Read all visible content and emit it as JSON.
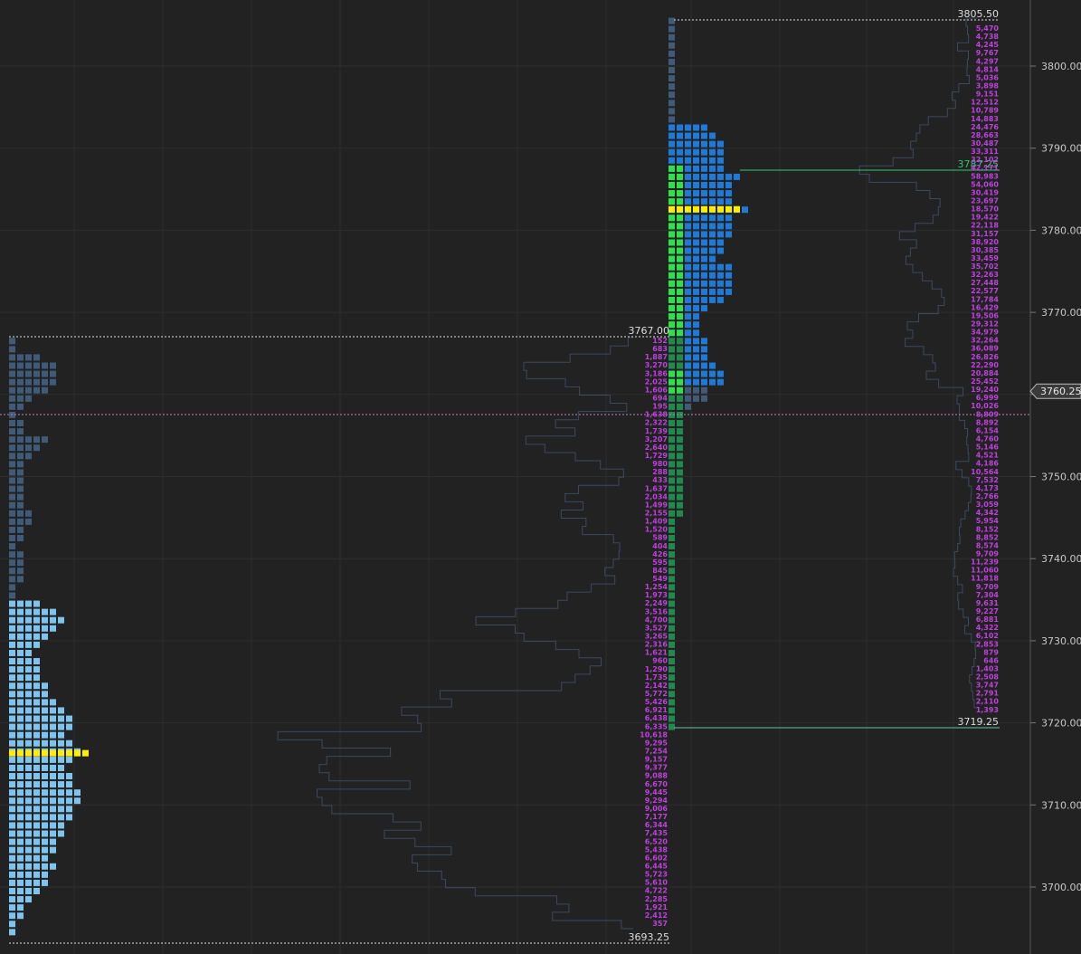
{
  "theme": {
    "background": "#222222",
    "grid": "#2e2e2e",
    "axis_text": "#c8c8c8",
    "volume_text": "#c040e0",
    "profile_outline": "#3a4a63",
    "cell_dark": "#3f5b78",
    "cell_mid": "#1e7ad6",
    "cell_light": "#7ec4ef",
    "cell_green": "#1f8a4c",
    "cell_bright_green": "#2ee04a",
    "poc": "#ffee00",
    "current_price_line": "#c080c0",
    "level_line_green": "#2fc86e"
  },
  "chart_data": {
    "type": "table",
    "y_axis": {
      "ticks": [
        "3800.00",
        "3790.00",
        "3780.00",
        "3770.00",
        "3760.00",
        "3750.00",
        "3740.00",
        "3730.00",
        "3720.00",
        "3710.00",
        "3700.00"
      ],
      "min": 3692.75,
      "max": 3806.5
    },
    "current_price": {
      "label": "3760.25",
      "value": 3757.75
    },
    "levels": [
      {
        "label": "3805.50",
        "value": 3805.5
      },
      {
        "label": "3767.00",
        "value": 3767.0
      },
      {
        "label": "3693.25",
        "value": 3693.25
      },
      {
        "label": "3787.25",
        "value": 3787.25
      },
      {
        "label": "3719.25",
        "value": 3719.25
      }
    ],
    "left_profile": {
      "poc_price": 3716.25,
      "rows": [
        {
          "top": 3767.0,
          "bottom": 3765.0,
          "cells": 1
        },
        {
          "top": 3765.0,
          "bottom": 3764.0,
          "cells": 4
        },
        {
          "top": 3764.0,
          "bottom": 3761.0,
          "cells": 6
        },
        {
          "top": 3761.0,
          "bottom": 3760.0,
          "cells": 5
        },
        {
          "top": 3760.0,
          "bottom": 3759.0,
          "cells": 3
        },
        {
          "top": 3759.0,
          "bottom": 3758.0,
          "cells": 2
        },
        {
          "top": 3758.0,
          "bottom": 3757.0,
          "cells": 1
        },
        {
          "top": 3757.0,
          "bottom": 3755.0,
          "cells": 2
        },
        {
          "top": 3755.0,
          "bottom": 3754.0,
          "cells": 5
        },
        {
          "top": 3754.0,
          "bottom": 3753.0,
          "cells": 4
        },
        {
          "top": 3753.0,
          "bottom": 3752.0,
          "cells": 3
        },
        {
          "top": 3752.0,
          "bottom": 3746.0,
          "cells": 2
        },
        {
          "top": 3746.0,
          "bottom": 3744.0,
          "cells": 3
        },
        {
          "top": 3744.0,
          "bottom": 3742.0,
          "cells": 2
        },
        {
          "top": 3742.0,
          "bottom": 3741.0,
          "cells": 1
        },
        {
          "top": 3741.0,
          "bottom": 3737.0,
          "cells": 2
        },
        {
          "top": 3737.0,
          "bottom": 3735.0,
          "cells": 1
        },
        {
          "top": 3735.0,
          "bottom": 3734.0,
          "cells": 4
        },
        {
          "top": 3734.0,
          "bottom": 3733.0,
          "cells": 6
        },
        {
          "top": 3733.0,
          "bottom": 3732.0,
          "cells": 7
        },
        {
          "top": 3732.0,
          "bottom": 3731.0,
          "cells": 6
        },
        {
          "top": 3731.0,
          "bottom": 3730.0,
          "cells": 5
        },
        {
          "top": 3730.0,
          "bottom": 3729.0,
          "cells": 4
        },
        {
          "top": 3729.0,
          "bottom": 3728.0,
          "cells": 3
        },
        {
          "top": 3728.0,
          "bottom": 3725.0,
          "cells": 4
        },
        {
          "top": 3725.0,
          "bottom": 3723.0,
          "cells": 5
        },
        {
          "top": 3723.0,
          "bottom": 3722.0,
          "cells": 6
        },
        {
          "top": 3722.0,
          "bottom": 3721.0,
          "cells": 7
        },
        {
          "top": 3721.0,
          "bottom": 3719.0,
          "cells": 8
        },
        {
          "top": 3719.0,
          "bottom": 3718.0,
          "cells": 7
        },
        {
          "top": 3718.0,
          "bottom": 3717.0,
          "cells": 8
        },
        {
          "top": 3717.0,
          "bottom": 3716.0,
          "cells": 9
        },
        {
          "top": 3716.0,
          "bottom": 3715.0,
          "cells": 8
        },
        {
          "top": 3715.0,
          "bottom": 3714.0,
          "cells": 7
        },
        {
          "top": 3714.0,
          "bottom": 3712.0,
          "cells": 8
        },
        {
          "top": 3712.0,
          "bottom": 3710.0,
          "cells": 9
        },
        {
          "top": 3710.0,
          "bottom": 3708.0,
          "cells": 8
        },
        {
          "top": 3708.0,
          "bottom": 3706.0,
          "cells": 7
        },
        {
          "top": 3706.0,
          "bottom": 3704.0,
          "cells": 6
        },
        {
          "top": 3704.0,
          "bottom": 3703.0,
          "cells": 5
        },
        {
          "top": 3703.0,
          "bottom": 3702.0,
          "cells": 6
        },
        {
          "top": 3702.0,
          "bottom": 3700.0,
          "cells": 5
        },
        {
          "top": 3700.0,
          "bottom": 3699.0,
          "cells": 4
        },
        {
          "top": 3699.0,
          "bottom": 3698.0,
          "cells": 3
        },
        {
          "top": 3698.0,
          "bottom": 3696.0,
          "cells": 2
        },
        {
          "top": 3696.0,
          "bottom": 3694.0,
          "cells": 1
        }
      ],
      "light_below": 3735.0
    },
    "right_profile": {
      "poc_price": 3782.5,
      "rows": [
        {
          "top": 3806.0,
          "bottom": 3793.0,
          "cells": 1
        },
        {
          "top": 3793.0,
          "bottom": 3792.0,
          "cells": 5
        },
        {
          "top": 3792.0,
          "bottom": 3791.0,
          "cells": 6
        },
        {
          "top": 3791.0,
          "bottom": 3787.0,
          "cells": 7
        },
        {
          "top": 3787.0,
          "bottom": 3786.0,
          "cells": 9
        },
        {
          "top": 3786.0,
          "bottom": 3783.0,
          "cells": 8
        },
        {
          "top": 3783.0,
          "bottom": 3782.0,
          "cells": 10
        },
        {
          "top": 3782.0,
          "bottom": 3779.0,
          "cells": 8
        },
        {
          "top": 3779.0,
          "bottom": 3777.0,
          "cells": 7
        },
        {
          "top": 3777.0,
          "bottom": 3776.0,
          "cells": 6
        },
        {
          "top": 3776.0,
          "bottom": 3772.0,
          "cells": 8
        },
        {
          "top": 3772.0,
          "bottom": 3771.0,
          "cells": 7
        },
        {
          "top": 3771.0,
          "bottom": 3770.0,
          "cells": 5
        },
        {
          "top": 3770.0,
          "bottom": 3767.0,
          "cells": 4
        },
        {
          "top": 3767.0,
          "bottom": 3764.0,
          "cells": 5
        },
        {
          "top": 3764.0,
          "bottom": 3763.0,
          "cells": 6
        },
        {
          "top": 3763.0,
          "bottom": 3761.0,
          "cells": 7
        },
        {
          "top": 3761.0,
          "bottom": 3759.0,
          "cells": 5
        },
        {
          "top": 3759.0,
          "bottom": 3758.0,
          "cells": 3
        }
      ],
      "green_column": [
        {
          "top": 3788.0,
          "bottom": 3767.0,
          "color": "bright_green"
        },
        {
          "top": 3767.0,
          "bottom": 3763.0,
          "color": "green"
        },
        {
          "top": 3763.0,
          "bottom": 3760.0,
          "color": "bright_green"
        },
        {
          "top": 3760.0,
          "bottom": 3745.0,
          "color": "green"
        },
        {
          "top": 3745.0,
          "bottom": 3719.0,
          "color": "green_single"
        }
      ]
    },
    "left_volumes": [
      "152",
      "683",
      "1,887",
      "3,270",
      "3,186",
      "2,025",
      "1,606",
      "694",
      "195",
      "1,638",
      "2,322",
      "1,739",
      "3,207",
      "2,640",
      "1,729",
      "980",
      "288",
      "433",
      "1,637",
      "2,034",
      "1,499",
      "2,155",
      "1,409",
      "1,520",
      "589",
      "404",
      "426",
      "595",
      "845",
      "549",
      "1,254",
      "1,973",
      "2,249",
      "3,516",
      "4,700",
      "3,527",
      "3,265",
      "2,316",
      "1,621",
      "960",
      "1,290",
      "1,735",
      "2,142",
      "5,772",
      "5,426",
      "6,921",
      "6,438",
      "6,335",
      "10,618",
      "9,295",
      "7,254",
      "9,157",
      "9,377",
      "9,088",
      "6,670",
      "9,445",
      "9,294",
      "9,006",
      "7,177",
      "6,344",
      "7,435",
      "6,520",
      "5,438",
      "6,602",
      "6,445",
      "5,723",
      "5,610",
      "4,722",
      "2,285",
      "1,921",
      "2,412",
      "357"
    ],
    "right_volumes": [
      "5,470",
      "4,738",
      "4,245",
      "9,767",
      "4,297",
      "4,814",
      "5,036",
      "3,898",
      "9,151",
      "12,512",
      "10,789",
      "14,883",
      "24,476",
      "28,663",
      "30,487",
      "33,311",
      "32,102",
      "42,171",
      "58,983",
      "54,060",
      "30,419",
      "23,697",
      "18,570",
      "19,422",
      "22,118",
      "31,157",
      "38,920",
      "30,385",
      "33,459",
      "35,702",
      "32,263",
      "27,448",
      "22,577",
      "17,784",
      "16,429",
      "19,506",
      "29,312",
      "34,979",
      "32,264",
      "36,089",
      "26,826",
      "22,290",
      "20,884",
      "25,452",
      "19,240",
      "6,999",
      "10,026",
      "8,809",
      "8,892",
      "6,154",
      "4,760",
      "5,146",
      "4,521",
      "4,186",
      "10,564",
      "7,532",
      "4,173",
      "2,766",
      "3,059",
      "4,342",
      "5,954",
      "8,152",
      "8,852",
      "8,574",
      "9,709",
      "11,239",
      "11,060",
      "11,818",
      "9,709",
      "7,304",
      "9,631",
      "9,227",
      "6,881",
      "4,322",
      "6,102",
      "2,853",
      "879",
      "646",
      "1,403",
      "2,508",
      "3,747",
      "2,791",
      "2,110",
      "1,393"
    ]
  }
}
